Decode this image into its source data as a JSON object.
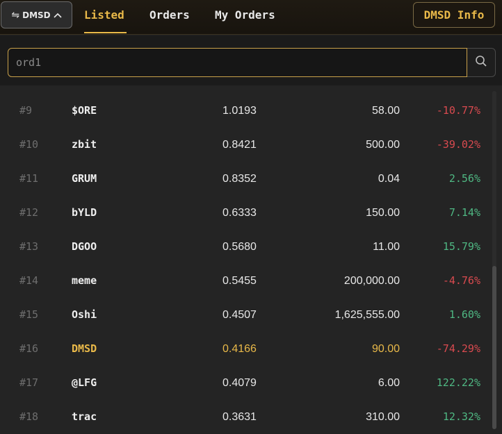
{
  "header": {
    "token_label": "DMSD",
    "tabs": [
      {
        "label": "Listed",
        "active": true
      },
      {
        "label": "Orders",
        "active": false
      },
      {
        "label": "My Orders",
        "active": false
      }
    ],
    "info_button": "DMSD Info"
  },
  "search": {
    "placeholder": "ord1",
    "value": ""
  },
  "colors": {
    "accent": "#e9b949",
    "negative": "#d94a4f",
    "positive": "#4fb883"
  },
  "rows": [
    {
      "rank": "#9",
      "name": "$ORE",
      "price": "1.0193",
      "volume": "58.00",
      "change": "-10.77%",
      "dir": "neg"
    },
    {
      "rank": "#10",
      "name": "zbit",
      "price": "0.8421",
      "volume": "500.00",
      "change": "-39.02%",
      "dir": "neg"
    },
    {
      "rank": "#11",
      "name": "GRUM",
      "price": "0.8352",
      "volume": "0.04",
      "change": "2.56%",
      "dir": "pos"
    },
    {
      "rank": "#12",
      "name": "bYLD",
      "price": "0.6333",
      "volume": "150.00",
      "change": "7.14%",
      "dir": "pos"
    },
    {
      "rank": "#13",
      "name": "DGOO",
      "price": "0.5680",
      "volume": "11.00",
      "change": "15.79%",
      "dir": "pos"
    },
    {
      "rank": "#14",
      "name": "meme",
      "price": "0.5455",
      "volume": "200,000.00",
      "change": "-4.76%",
      "dir": "neg"
    },
    {
      "rank": "#15",
      "name": "Oshi",
      "price": "0.4507",
      "volume": "1,625,555.00",
      "change": "1.60%",
      "dir": "pos"
    },
    {
      "rank": "#16",
      "name": "DMSD",
      "price": "0.4166",
      "volume": "90.00",
      "change": "-74.29%",
      "dir": "neg",
      "highlight": true
    },
    {
      "rank": "#17",
      "name": "@LFG",
      "price": "0.4079",
      "volume": "6.00",
      "change": "122.22%",
      "dir": "pos"
    },
    {
      "rank": "#18",
      "name": "trac",
      "price": "0.3631",
      "volume": "310.00",
      "change": "12.32%",
      "dir": "pos"
    }
  ]
}
